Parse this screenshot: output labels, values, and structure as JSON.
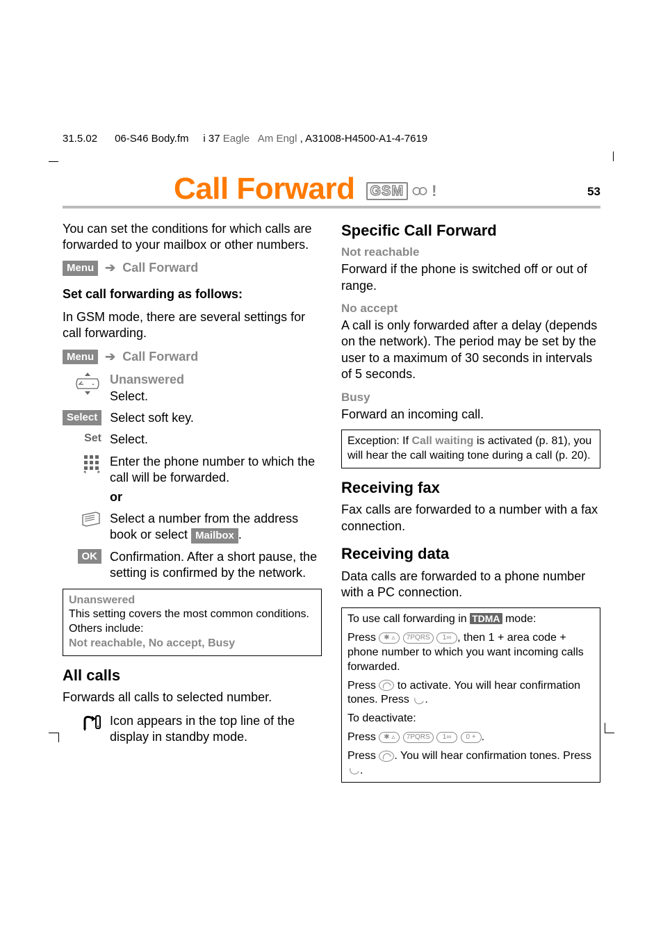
{
  "header": {
    "date": "31.5.02",
    "file": "06-S46 Body.fm",
    "seq": "i 37",
    "product": "Eagle",
    "lang": "Am Engl",
    "doc_no": "A31008-H4500-A1-4-7619"
  },
  "title": "Call Forward",
  "title_badges": {
    "gsm": "GSM"
  },
  "page_number": "53",
  "left": {
    "intro": "You can set the conditions for which calls are forwarded to your mailbox or other numbers.",
    "menu_label": "Menu",
    "menu_target": "Call Forward",
    "set_heading": "Set call forwarding as follows:",
    "gsm_intro": "In GSM mode, there are several settings for call forwarding.",
    "steps": {
      "nav_label": "Unanswered",
      "nav_action": "Select.",
      "select_key": "Select",
      "select_action": "Select soft key.",
      "set_key": "Set",
      "set_action": "Select.",
      "keypad_action": "Enter the phone number to which the call will be forwarded.",
      "or": "or",
      "book_action_pre": "Select a number from the address book or select ",
      "mailbox_chip": "Mailbox",
      "book_action_post": ".",
      "ok_key": "OK",
      "ok_action": "Confirmation. After a short pause, the setting is confirmed by the network."
    },
    "info_box": {
      "title": "Unanswered",
      "body": "This setting covers the most common conditions. Others include:",
      "conditions": "Not reachable, No accept, Busy"
    },
    "all_calls": {
      "heading": "All calls",
      "body": "Forwards all calls to selected number.",
      "icon_note": "Icon appears in the top line of the display in standby mode."
    }
  },
  "right": {
    "specific": {
      "heading": "Specific Call Forward",
      "not_reachable_label": "Not reachable",
      "not_reachable_body": "Forward if the phone is switched off or out of range.",
      "no_accept_label": "No accept",
      "no_accept_body": "A call is only forwarded after a delay (depends on the network). The period may be set by the user to a maximum of 30 seconds in intervals of 5 seconds.",
      "busy_label": "Busy",
      "busy_body": "Forward an incoming call.",
      "exception_pre": "Exception: If ",
      "exception_bold": "Call waiting",
      "exception_post": " is activated (p. 81), you will hear the call waiting tone during a call (p. 20)."
    },
    "fax": {
      "heading": "Receiving fax",
      "body": "Fax calls are forwarded to a number with a fax connection."
    },
    "data": {
      "heading": "Receiving data",
      "body": "Data calls are forwarded to a phone number with a PC connection."
    },
    "tdma_box": {
      "line1_pre": "To use call forwarding in ",
      "tdma": "TDMA",
      "line1_post": " mode:",
      "press": "Press ",
      "keys_activate_tail": ", then 1 + area code + phone number to which you want incoming calls forwarded.",
      "activate_line_pre": "Press ",
      "activate_line_mid": " to activate. You will hear confirmation tones. Press ",
      "period": ".",
      "deactivate_label": "To deactivate:",
      "confirm_line_pre": "Press ",
      "confirm_line_mid": ". You will hear confirmation tones. Press ",
      "key_star": "✱ ▵",
      "key_7": "7PQRS",
      "key_1": "1∞",
      "key_0": "0 +"
    }
  }
}
